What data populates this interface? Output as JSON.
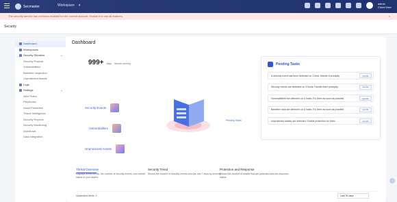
{
  "topbar": {
    "product": "Secmaster",
    "selector_label": "Workspace",
    "user_name": "admin",
    "user_sub": "Cloud User"
  },
  "alert": {
    "text": "The security service has not been enabled for the current account. Enable it to use all features.",
    "close": "×"
  },
  "breadcrumb": "Security",
  "sidebar": {
    "items": [
      {
        "label": "Dashboard",
        "type": "active"
      },
      {
        "label": "Workspaces",
        "type": "group"
      },
      {
        "label": "Security Situation",
        "type": "group"
      },
      {
        "label": "Security Posture",
        "type": "sub"
      },
      {
        "label": "Vulnerabilities",
        "type": "sub"
      },
      {
        "label": "Baseline Inspection",
        "type": "sub"
      },
      {
        "label": "Unprotected Assets",
        "type": "sub"
      },
      {
        "label": "Logs",
        "type": "group"
      },
      {
        "label": "Settings",
        "type": "group"
      },
      {
        "label": "Alert Rules",
        "type": "sub"
      },
      {
        "label": "Playbooks",
        "type": "sub"
      },
      {
        "label": "Asset Protection",
        "type": "sub"
      },
      {
        "label": "Threat Intelligence",
        "type": "sub"
      },
      {
        "label": "Security Reports",
        "type": "sub"
      },
      {
        "label": "Security Monitoring",
        "type": "sub"
      },
      {
        "label": "Workflows",
        "type": "sub"
      },
      {
        "label": "Data Integration",
        "type": "sub"
      }
    ]
  },
  "main": {
    "title": "Dashboard",
    "kpi_value": "999+",
    "kpi_unit": "days",
    "kpi_text": "Secure running",
    "features": [
      "Security Events",
      "Vulnerabilities",
      "Unprotected Assets"
    ],
    "right_label": "Pending Tasks"
  },
  "pending": {
    "title": "Pending Tasks",
    "tasks": [
      {
        "text": "A security event has been detected on 1 host. Handle it promptly.",
        "btn": "Handle"
      },
      {
        "text": "Security events are detected on 3 hosts. Handle them promptly.",
        "btn": "Handle"
      },
      {
        "text": "Vulnerabilities are detected on 5 hosts. Fix them as soon as possible.",
        "btn": "Handle"
      },
      {
        "text": "Baseline risks are detected on 8 hosts. Fix them as soon as possible.",
        "btn": "Handle"
      },
      {
        "text": "Unprotected assets are detected. Enable protection for them.",
        "btn": "Handle"
      }
    ]
  },
  "bottom": {
    "cols": [
      {
        "title": "Threat Overview",
        "desc": "Displays threat trends, the number of security events, and overall status of your assets.",
        "active": true
      },
      {
        "title": "Security Trend",
        "desc": "Shows the number of security events over the last 7 days by severity.",
        "active": false
      },
      {
        "title": "Protection and Response",
        "desc": "Shows the number of assets that are protected and the response status.",
        "active": false
      }
    ]
  },
  "footer": {
    "label": "Unhandled Alerts: 2",
    "select": "Last 30 days"
  },
  "colors": {
    "brand": "#2f56d6",
    "topbar": "#24377a",
    "alert_bg": "#fde8e8",
    "alert_text": "#c23b3b"
  }
}
